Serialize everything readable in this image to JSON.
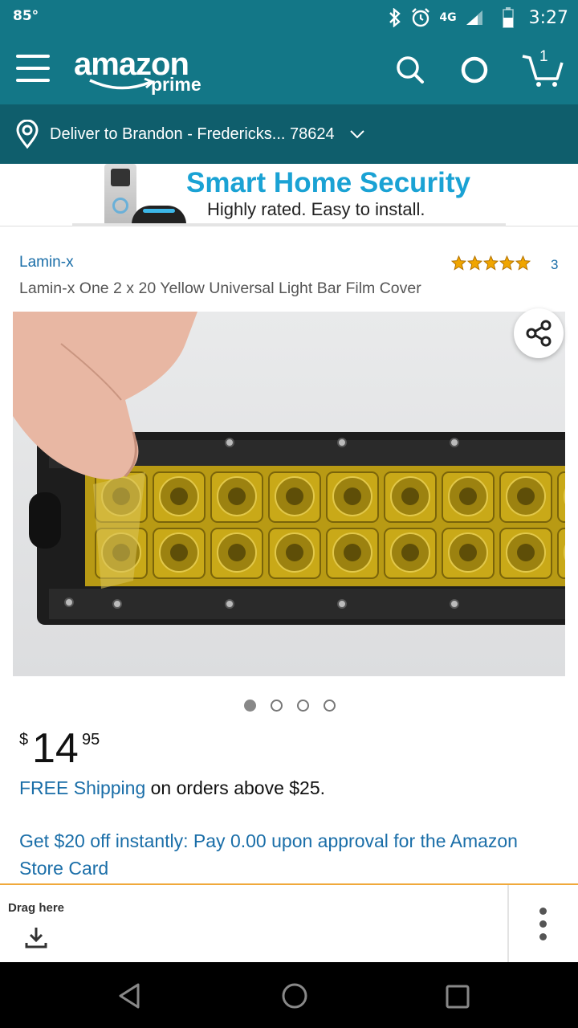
{
  "status_bar": {
    "temperature": "85°",
    "network": "4G",
    "time": "3:27"
  },
  "header": {
    "logo_text": "amazon",
    "logo_subtext": "prime",
    "cart_count": "1",
    "icons": [
      "menu-icon",
      "search-icon",
      "alexa-icon",
      "cart-icon"
    ]
  },
  "delivery": {
    "text": "Deliver to Brandon - Fredericks... 78624"
  },
  "banner": {
    "title": "Smart Home Security",
    "subtitle": "Highly rated. Easy to install."
  },
  "product": {
    "brand": "Lamin-x",
    "rating_stars": 5,
    "rating_count": "3",
    "title": "Lamin-x One 2 x 20 Yellow Universal Light Bar Film Cover",
    "image_count": 4,
    "active_image": 0,
    "price_symbol": "$",
    "price_whole": "14",
    "price_fraction": "95",
    "shipping_link": "FREE Shipping",
    "shipping_rest": " on orders above $25.",
    "promo": "Get $20 off instantly: Pay 0.00 upon approval for the Amazon Store Card"
  },
  "drag_bar": {
    "label": "Drag here"
  },
  "colors": {
    "header_teal": "#137787",
    "delivery_teal": "#0f5e6c",
    "link_blue": "#1a6ea8",
    "star_orange": "#f0a500",
    "banner_blue": "#1aa2d4"
  }
}
